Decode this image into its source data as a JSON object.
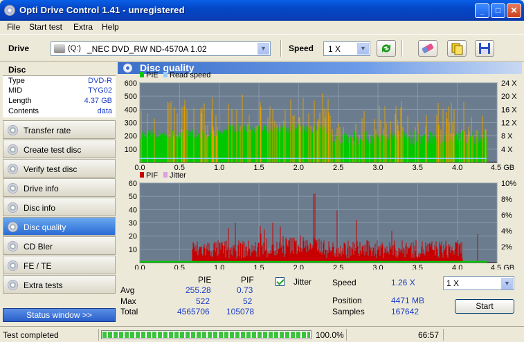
{
  "window": {
    "title": "Opti Drive Control 1.41 - unregistered",
    "min": "_",
    "max": "□",
    "close": "✕"
  },
  "menu": [
    "File",
    "Start test",
    "Extra",
    "Help"
  ],
  "toolbar": {
    "drive_label": "Drive",
    "drive_letter": "(Q:)",
    "drive_value": "_NEC DVD_RW ND-4570A 1.02",
    "speed_label": "Speed",
    "speed_value": "1 X"
  },
  "disc": {
    "header": "Disc",
    "rows": [
      {
        "k": "Type",
        "v": "DVD-R"
      },
      {
        "k": "MID",
        "v": "TYG02"
      },
      {
        "k": "Length",
        "v": "4.37 GB"
      },
      {
        "k": "Contents",
        "v": "data"
      }
    ]
  },
  "nav": [
    {
      "label": "Transfer rate",
      "active": false
    },
    {
      "label": "Create test disc",
      "active": false
    },
    {
      "label": "Verify test disc",
      "active": false
    },
    {
      "label": "Drive info",
      "active": false
    },
    {
      "label": "Disc info",
      "active": false
    },
    {
      "label": "Disc quality",
      "active": true
    },
    {
      "label": "CD Bler",
      "active": false
    },
    {
      "label": "FE / TE",
      "active": false
    },
    {
      "label": "Extra tests",
      "active": false
    }
  ],
  "status_window": "Status window >>",
  "panel_title": "Disc quality",
  "colors": {
    "plot_bg": "#6b7c8e",
    "pie": "#00c800",
    "read": "#99ccff",
    "pif": "#c80000",
    "jitter": "#ff8888",
    "orange": "#e0a000"
  },
  "chart_data": [
    {
      "type": "bar",
      "legend": [
        "PIE",
        "Read speed"
      ],
      "x_ticks": [
        "0.0",
        "0.5",
        "1.0",
        "1.5",
        "2.0",
        "2.5",
        "3.0",
        "3.5",
        "4.0",
        "4.5 GB"
      ],
      "y_ticks": [
        "600",
        "500",
        "400",
        "300",
        "200",
        "100"
      ],
      "y2_ticks": [
        "24 X",
        "20 X",
        "16 X",
        "12 X",
        "8 X",
        "4 X"
      ],
      "xlim": [
        0,
        4.5
      ],
      "ylim": [
        0,
        600
      ],
      "series": [
        {
          "name": "PIE",
          "baseline": 250,
          "max": 522,
          "avg": 255.28
        }
      ],
      "read_speed_x": [
        0,
        4.37
      ],
      "read_speed_y": [
        1,
        1.26
      ]
    },
    {
      "type": "bar",
      "legend": [
        "PIF",
        "Jitter"
      ],
      "x_ticks": [
        "0.0",
        "0.5",
        "1.0",
        "1.5",
        "2.0",
        "2.5",
        "3.0",
        "3.5",
        "4.0",
        "4.5 GB"
      ],
      "y_ticks": [
        "60",
        "50",
        "40",
        "30",
        "20",
        "10"
      ],
      "y2_ticks": [
        "10%",
        "8%",
        "6%",
        "4%",
        "2%"
      ],
      "xlim": [
        0,
        4.5
      ],
      "ylim": [
        0,
        60
      ],
      "series": [
        {
          "name": "PIF",
          "max": 52,
          "avg": 0.73
        }
      ]
    }
  ],
  "stats": {
    "col_pie": "PIE",
    "col_pif": "PIF",
    "rows": [
      {
        "k": "Avg",
        "pie": "255.28",
        "pif": "0.73"
      },
      {
        "k": "Max",
        "pie": "522",
        "pif": "52"
      },
      {
        "k": "Total",
        "pie": "4565706",
        "pif": "105078"
      }
    ],
    "jitter_label": "Jitter",
    "speed_label": "Speed",
    "speed_value": "1.26 X",
    "position_label": "Position",
    "position_value": "4471 MB",
    "samples_label": "Samples",
    "samples_value": "167642",
    "speed_select": "1 X",
    "start": "Start"
  },
  "statusbar": {
    "text": "Test completed",
    "progress": 1.0,
    "pct": "100.0%",
    "time": "66:57"
  }
}
